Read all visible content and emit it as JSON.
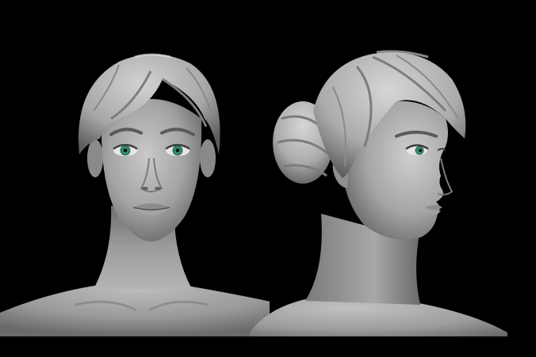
{
  "scene": {
    "background": "#000000",
    "sculpt_color": "#9a9a9a",
    "iris_color": "#3f9e86",
    "views": [
      {
        "id": "front",
        "icon": "female-head-front-sculpt"
      },
      {
        "id": "side",
        "icon": "female-head-three-quarter-sculpt"
      }
    ]
  }
}
